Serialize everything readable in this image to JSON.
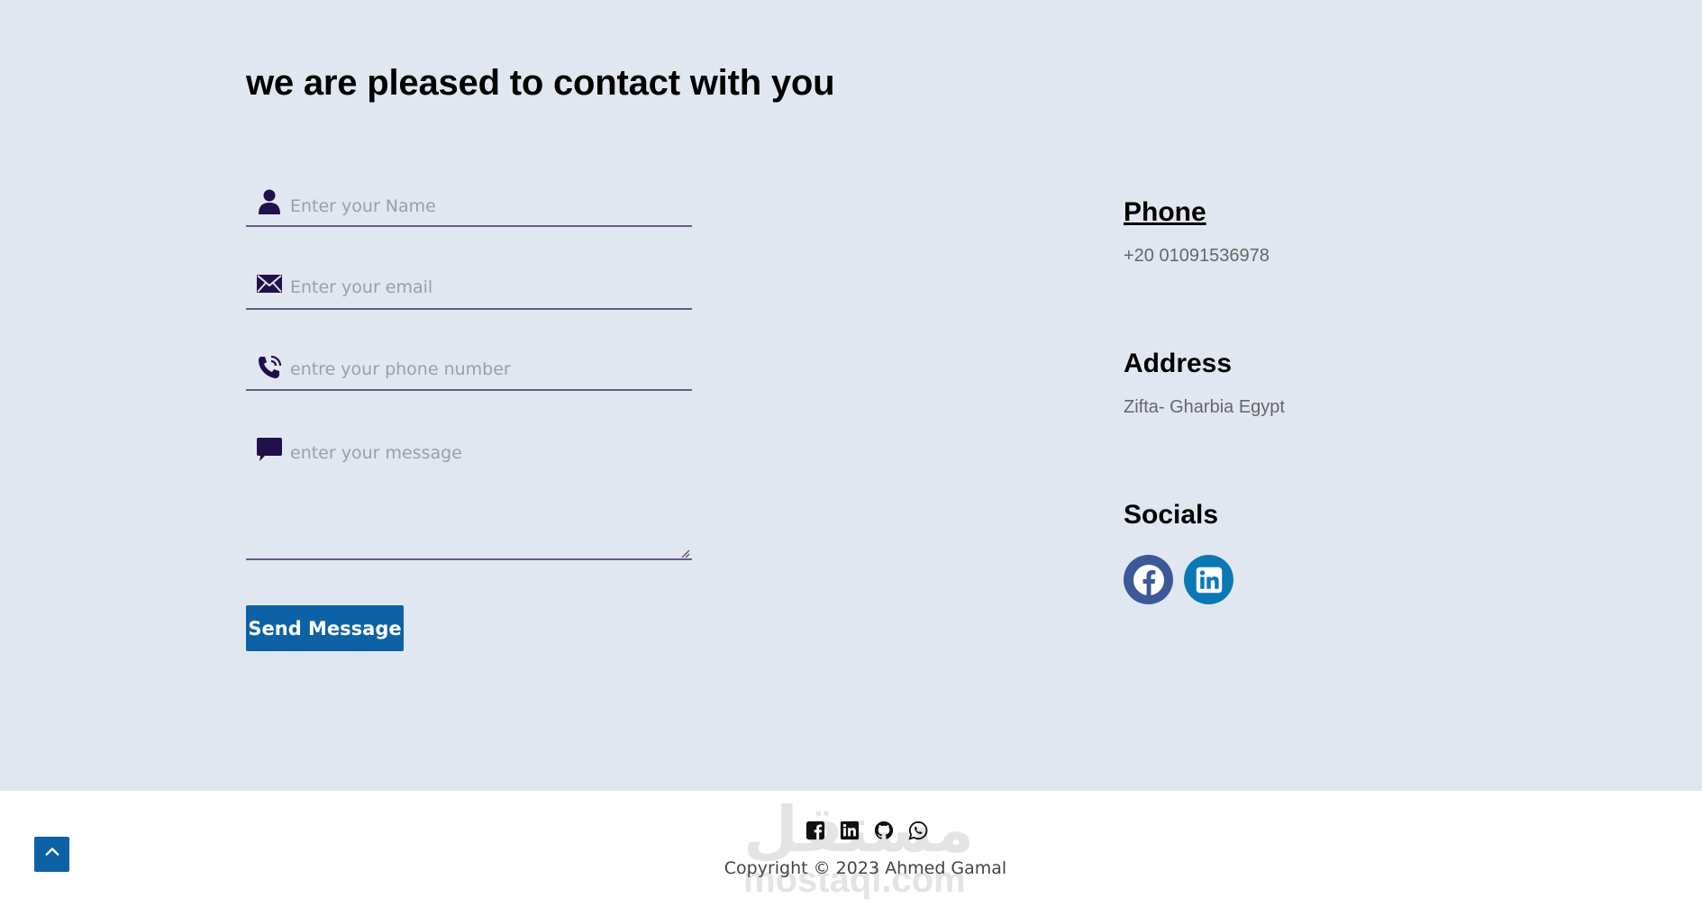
{
  "contact": {
    "heading": "we are pleased to contact with you",
    "form": {
      "name_placeholder": "Enter your Name",
      "email_placeholder": "Enter your email",
      "phone_placeholder": "entre your phone number",
      "message_placeholder": "enter your message",
      "send_label": "Send Message",
      "icon_color": "#22104a"
    },
    "info": {
      "phone_title": "Phone",
      "phone_value": "+20 01091536978",
      "address_title": "Address",
      "address_value": "Zifta- Gharbia Egypt",
      "socials_title": "Socials",
      "socials": [
        {
          "name": "facebook-icon",
          "color": "#3b5998"
        },
        {
          "name": "linkedin-icon",
          "color": "#0a78b5"
        }
      ]
    }
  },
  "footer": {
    "icons": [
      "facebook-square-icon",
      "linkedin-square-icon",
      "github-icon",
      "whatsapp-icon"
    ],
    "copyright": "Copyright © 2023 Ahmed Gamal",
    "watermark_arabic": "مستقل",
    "watermark_latin": "mostaql.com"
  },
  "colors": {
    "section_bg": "#e1e7f0",
    "accent": "#0d62a5"
  }
}
